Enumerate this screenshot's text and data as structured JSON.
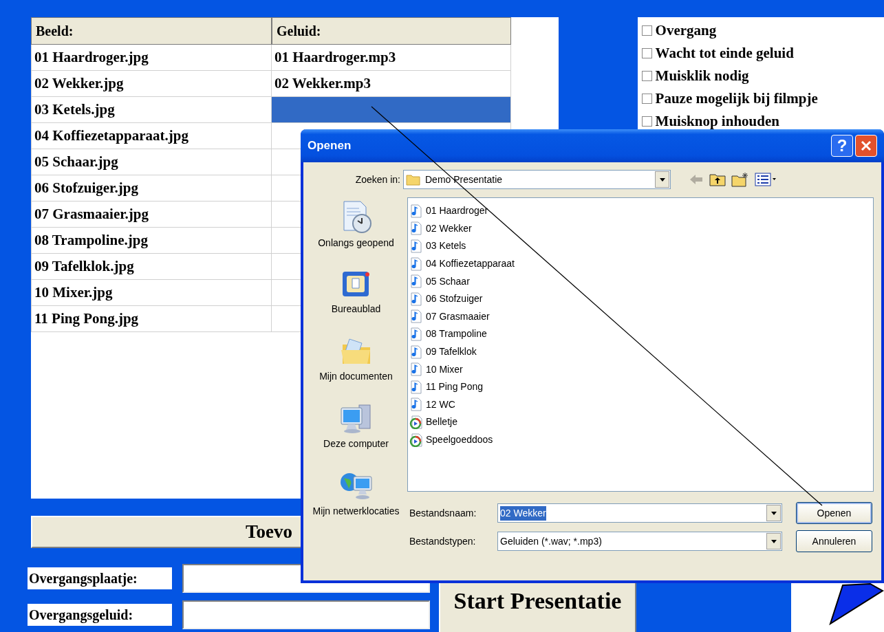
{
  "table": {
    "columns": [
      "Beeld:",
      "Geluid:"
    ],
    "rows": [
      {
        "image": "01 Haardroger.jpg",
        "sound": "01 Haardroger.mp3",
        "selected": false
      },
      {
        "image": "02 Wekker.jpg",
        "sound": "02 Wekker.mp3",
        "selected": false
      },
      {
        "image": "03 Ketels.jpg",
        "selected": true
      },
      {
        "image": "04 Koffiezetapparaat.jpg",
        "selected": false
      },
      {
        "image": "05 Schaar.jpg",
        "selected": false
      },
      {
        "image": "06 Stofzuiger.jpg",
        "selected": false
      },
      {
        "image": "07 Grasmaaier.jpg",
        "selected": false
      },
      {
        "image": "08 Trampoline.jpg",
        "selected": false
      },
      {
        "image": "09 Tafelklok.jpg",
        "selected": false
      },
      {
        "image": "10 Mixer.jpg",
        "selected": false
      },
      {
        "image": "11 Ping Pong.jpg",
        "selected": false
      }
    ]
  },
  "options": [
    {
      "label": "Overgang",
      "checked": false
    },
    {
      "label": "Wacht tot einde geluid",
      "checked": false
    },
    {
      "label": "Muisklik nodig",
      "checked": false
    },
    {
      "label": "Pauze mogelijk bij filmpje",
      "checked": false
    },
    {
      "label": "Muisknop inhouden",
      "checked": false
    }
  ],
  "add_button": "Toevo",
  "fields": [
    {
      "label": "Overgangsplaatje:"
    },
    {
      "label": "Overgangsgeluid:"
    }
  ],
  "start_button": "Start Presentatie",
  "dialog": {
    "title": "Openen",
    "help_button": "?",
    "look_in": {
      "label": "Zoeken in:",
      "value": "Demo Presentatie"
    },
    "places": [
      {
        "label": "Onlangs geopend",
        "kind": "recent"
      },
      {
        "label": "Bureaublad",
        "kind": "desktop"
      },
      {
        "label": "Mijn documenten",
        "kind": "documents"
      },
      {
        "label": "Deze computer",
        "kind": "computer"
      },
      {
        "label": "Mijn netwerklocaties",
        "kind": "network"
      }
    ],
    "files": [
      {
        "name": "01 Haardroger",
        "kind": "audio"
      },
      {
        "name": "02 Wekker",
        "kind": "audio"
      },
      {
        "name": "03 Ketels",
        "kind": "audio"
      },
      {
        "name": "04 Koffiezetapparaat",
        "kind": "audio"
      },
      {
        "name": "05 Schaar",
        "kind": "audio"
      },
      {
        "name": "06 Stofzuiger",
        "kind": "audio"
      },
      {
        "name": "07 Grasmaaier",
        "kind": "audio"
      },
      {
        "name": "08 Trampoline",
        "kind": "audio"
      },
      {
        "name": "09 Tafelklok",
        "kind": "audio"
      },
      {
        "name": "10 Mixer",
        "kind": "audio"
      },
      {
        "name": "11 Ping Pong",
        "kind": "audio"
      },
      {
        "name": "12 WC",
        "kind": "audio"
      },
      {
        "name": "Belletje",
        "kind": "media"
      },
      {
        "name": "Speelgoeddoos",
        "kind": "media"
      }
    ],
    "filename": {
      "label": "Bestandsnaam:",
      "value": "02 Wekker",
      "selected": true
    },
    "filetype": {
      "label": "Bestandstypen:",
      "value": "Geluiden (*.wav; *.mp3)"
    },
    "open_button": "Openen",
    "cancel_button": "Annuleren"
  }
}
